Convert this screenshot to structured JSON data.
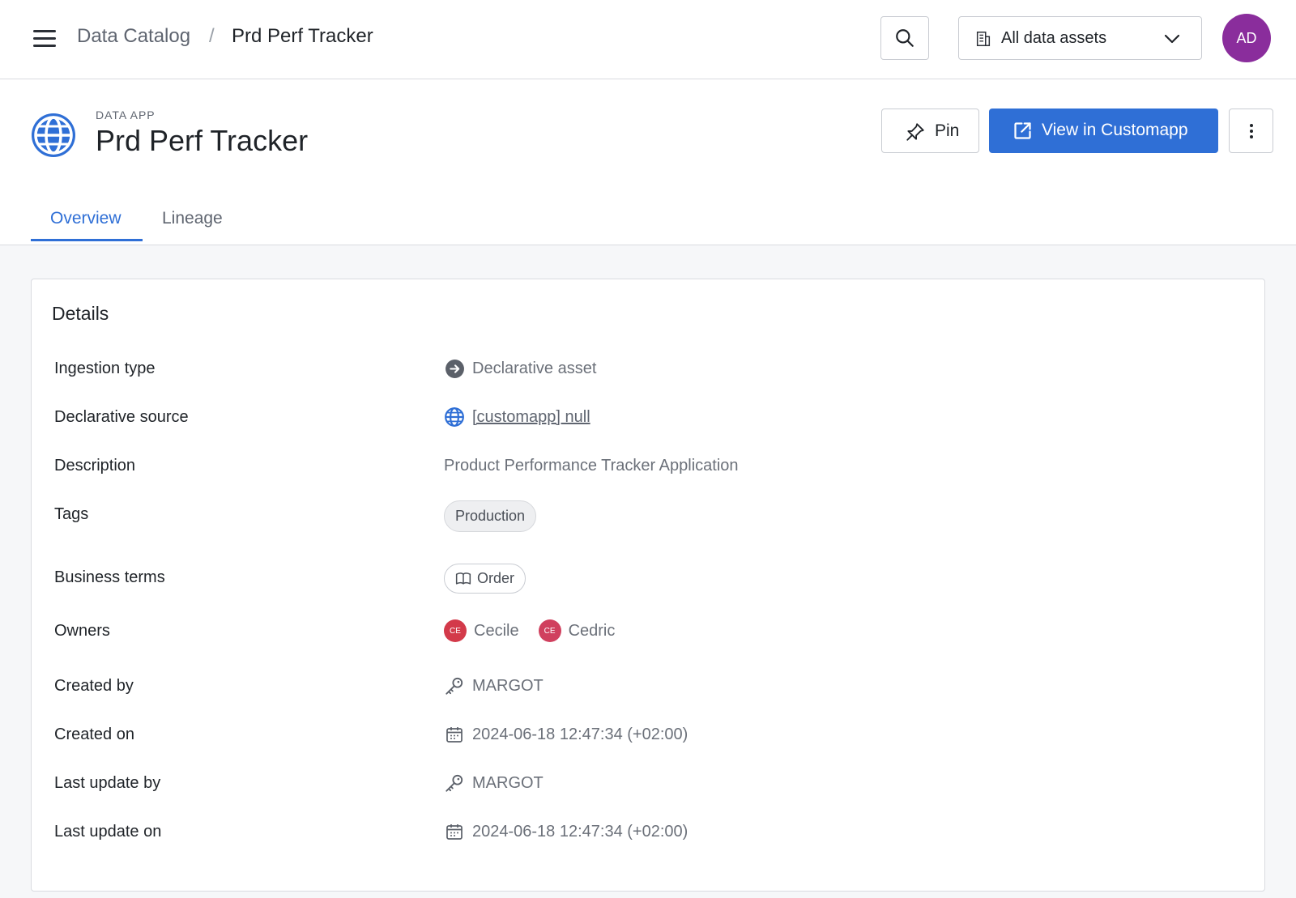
{
  "topbar": {
    "breadcrumb_root": "Data Catalog",
    "breadcrumb_separator": "/",
    "breadcrumb_current": "Prd Perf Tracker",
    "asset_filter": "All data assets",
    "avatar_initials": "AD",
    "avatar_color": "#8a2d9c"
  },
  "header": {
    "kind": "DATA APP",
    "title": "Prd Perf Tracker",
    "icon": "globe-icon",
    "pin_label": "Pin",
    "view_label": "View in Customapp",
    "accent_color": "#2f6fd6"
  },
  "tabs": [
    {
      "label": "Overview",
      "active": true
    },
    {
      "label": "Lineage",
      "active": false
    }
  ],
  "details": {
    "title": "Details",
    "ingestion_type": {
      "label": "Ingestion type",
      "value": "Declarative asset",
      "icon": "arrow-circle-icon"
    },
    "declarative_source": {
      "label": "Declarative source",
      "value": "[customapp] null",
      "icon": "globe-icon"
    },
    "description": {
      "label": "Description",
      "value": "Product Performance Tracker Application"
    },
    "tags": {
      "label": "Tags",
      "items": [
        "Production"
      ]
    },
    "business_terms": {
      "label": "Business terms",
      "items": [
        "Order"
      ],
      "icon": "book-icon"
    },
    "owners": {
      "label": "Owners",
      "items": [
        {
          "initials": "CE",
          "name": "Cecile"
        },
        {
          "initials": "CE",
          "name": "Cedric"
        }
      ]
    },
    "created_by": {
      "label": "Created by",
      "value": "MARGOT",
      "icon": "key-icon"
    },
    "created_on": {
      "label": "Created on",
      "value": "2024-06-18 12:47:34 (+02:00)",
      "icon": "calendar-icon"
    },
    "last_update_by": {
      "label": "Last update by",
      "value": "MARGOT",
      "icon": "key-icon"
    },
    "last_update_on": {
      "label": "Last update on",
      "value": "2024-06-18 12:47:34 (+02:00)",
      "icon": "calendar-icon"
    }
  }
}
